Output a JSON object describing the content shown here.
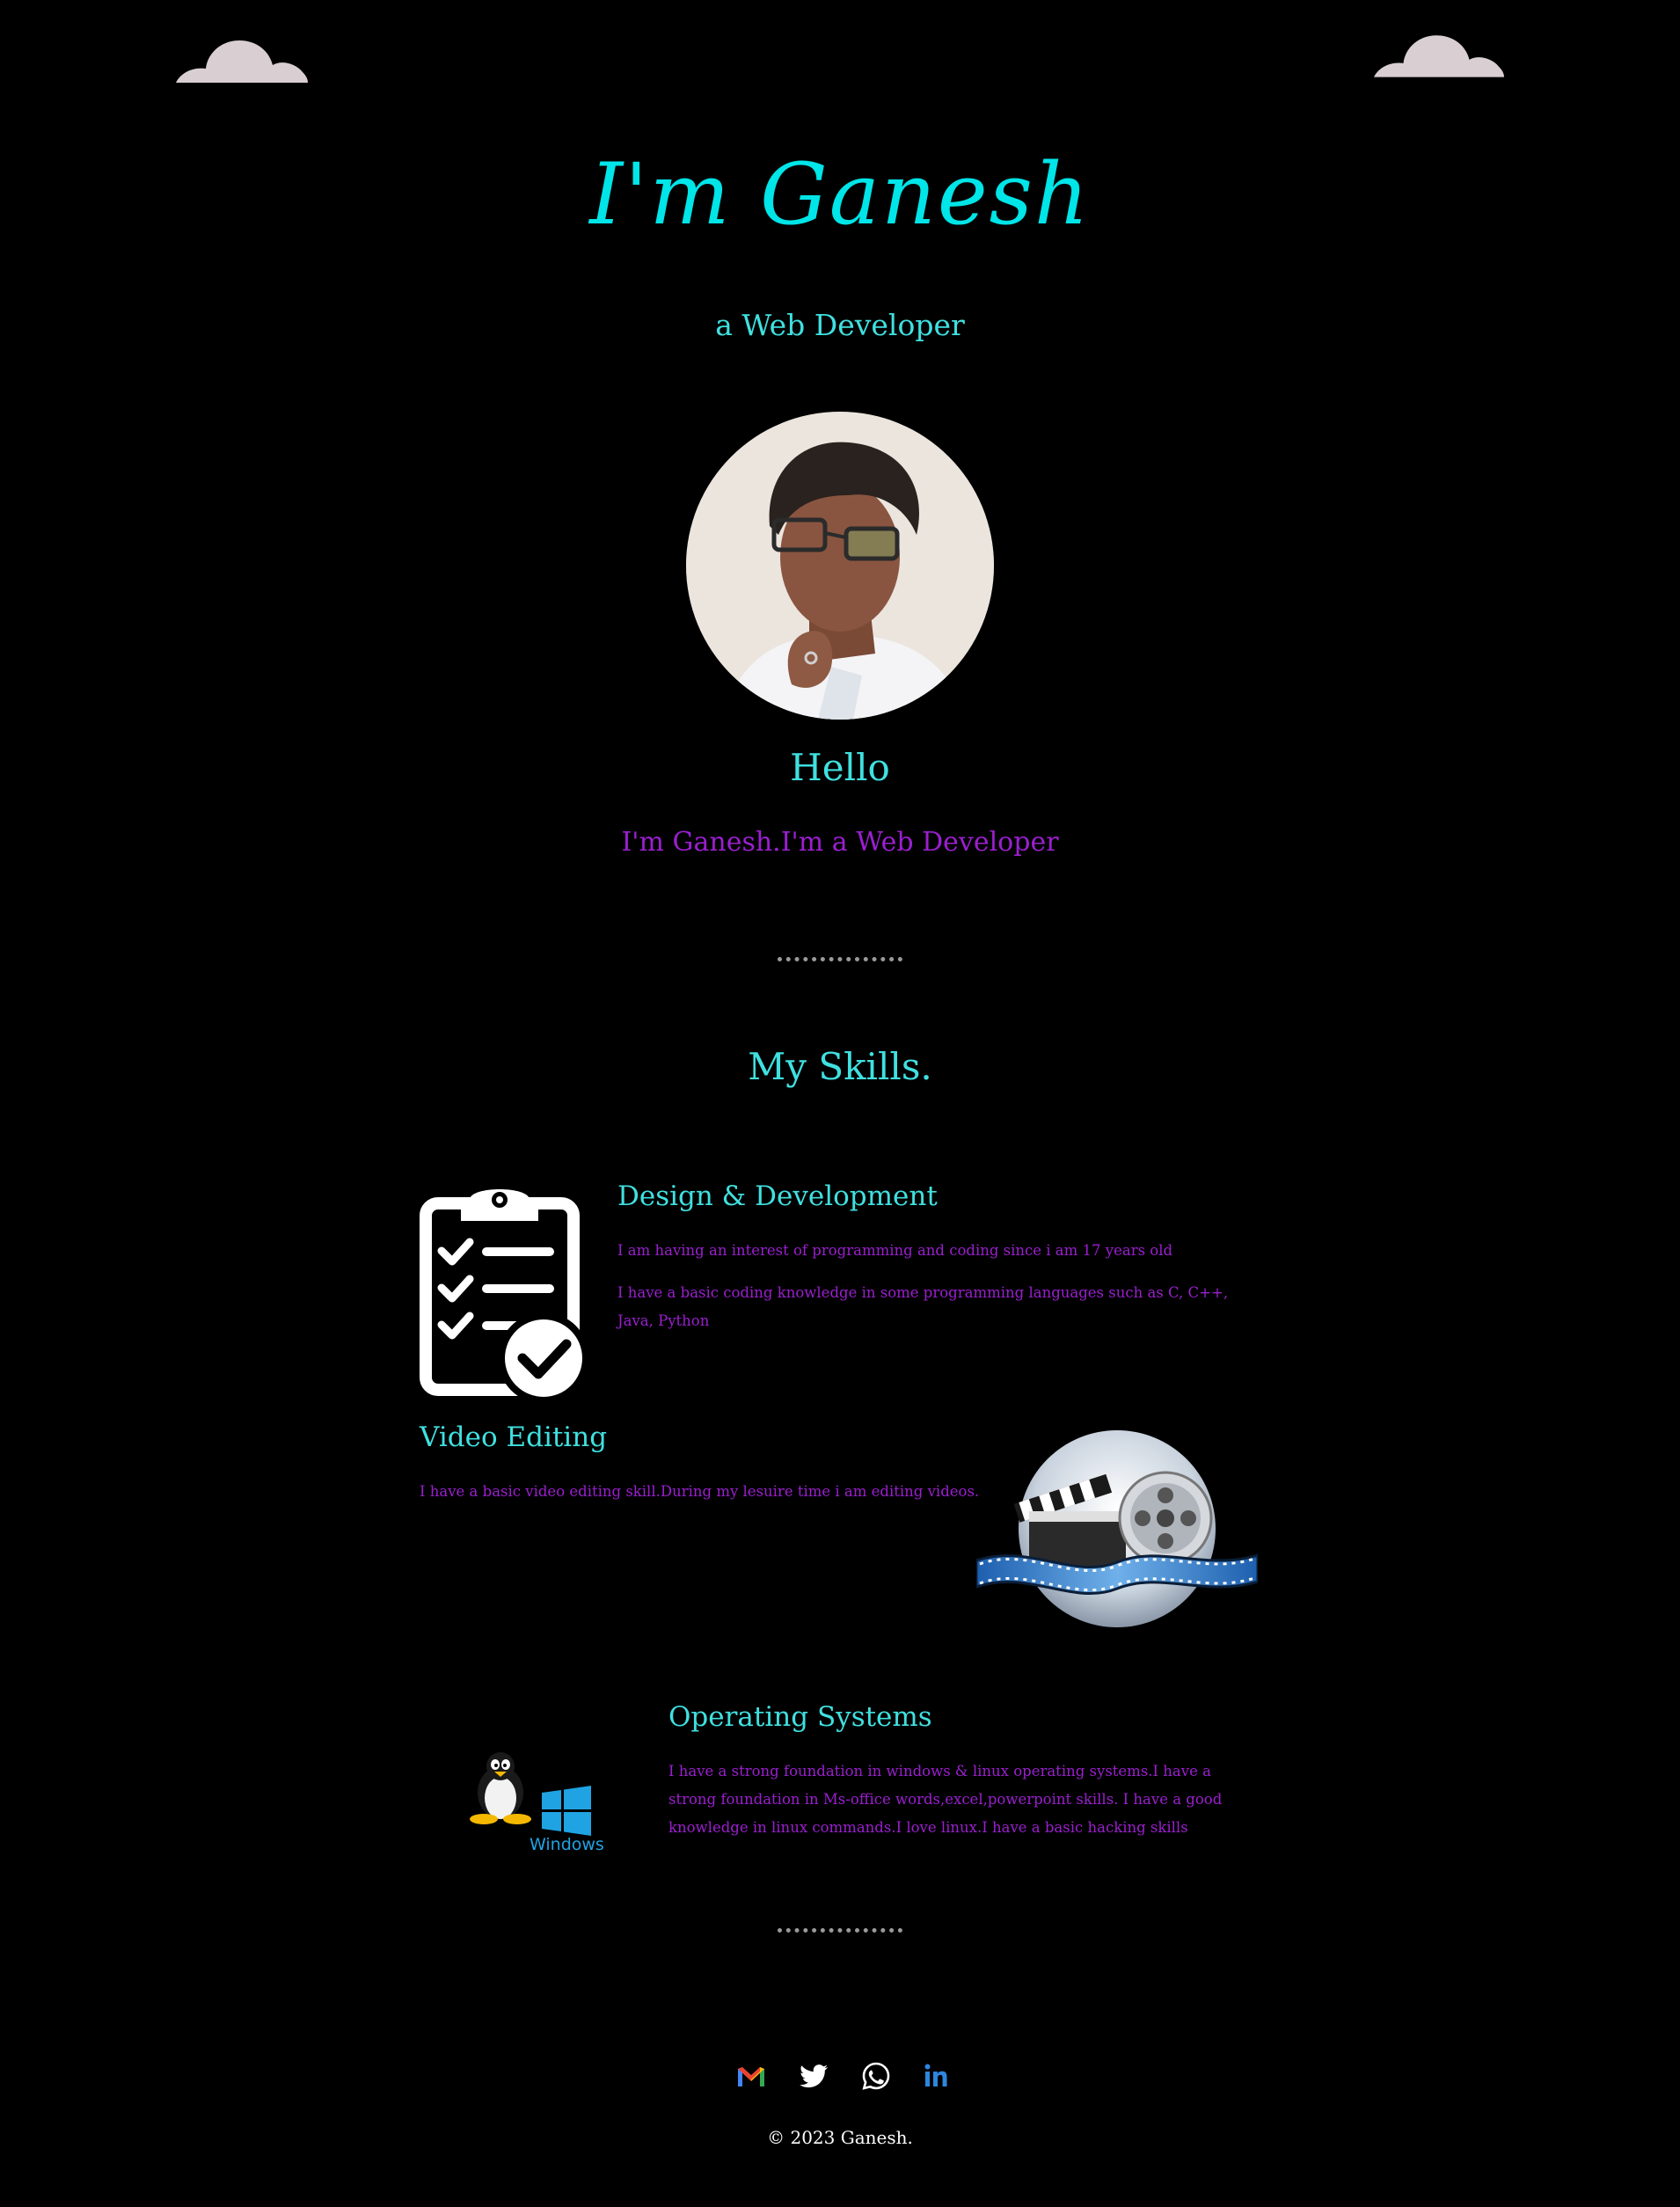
{
  "hero": {
    "name_heading": "I'm Ganesh",
    "role_subtitle": "a Web Developer"
  },
  "about": {
    "greeting": "Hello",
    "intro": "I'm Ganesh.I'm a Web Developer"
  },
  "skills": {
    "heading": "My Skills.",
    "items": [
      {
        "title": "Design & Development",
        "paragraphs": [
          "I am having an interest of programming and coding since i am 17 years old",
          "I have a basic coding knowledge in some programming languages such as C, C++, Java, Python"
        ]
      },
      {
        "title": "Video Editing",
        "paragraphs": [
          "I have a basic video editing skill.During my lesuire time i am editing videos."
        ]
      },
      {
        "title": "Operating Systems",
        "paragraphs": [
          "I have a strong foundation in windows & linux operating systems.I have a strong foundation in Ms-office words,excel,powerpoint skills. I have a good knowledge in linux commands.I love linux.I have a basic hacking skills"
        ],
        "logo_label": "Windows"
      }
    ]
  },
  "footer": {
    "social_icons": [
      "gmail-icon",
      "twitter-icon",
      "whatsapp-icon",
      "linkedin-icon"
    ],
    "copyright": "© 2023 Ganesh."
  },
  "colors": {
    "background": "#000000",
    "accent_cyan": "#40e0e0",
    "accent_purple": "#9b1fcf",
    "cloud": "#d9cfd3"
  }
}
